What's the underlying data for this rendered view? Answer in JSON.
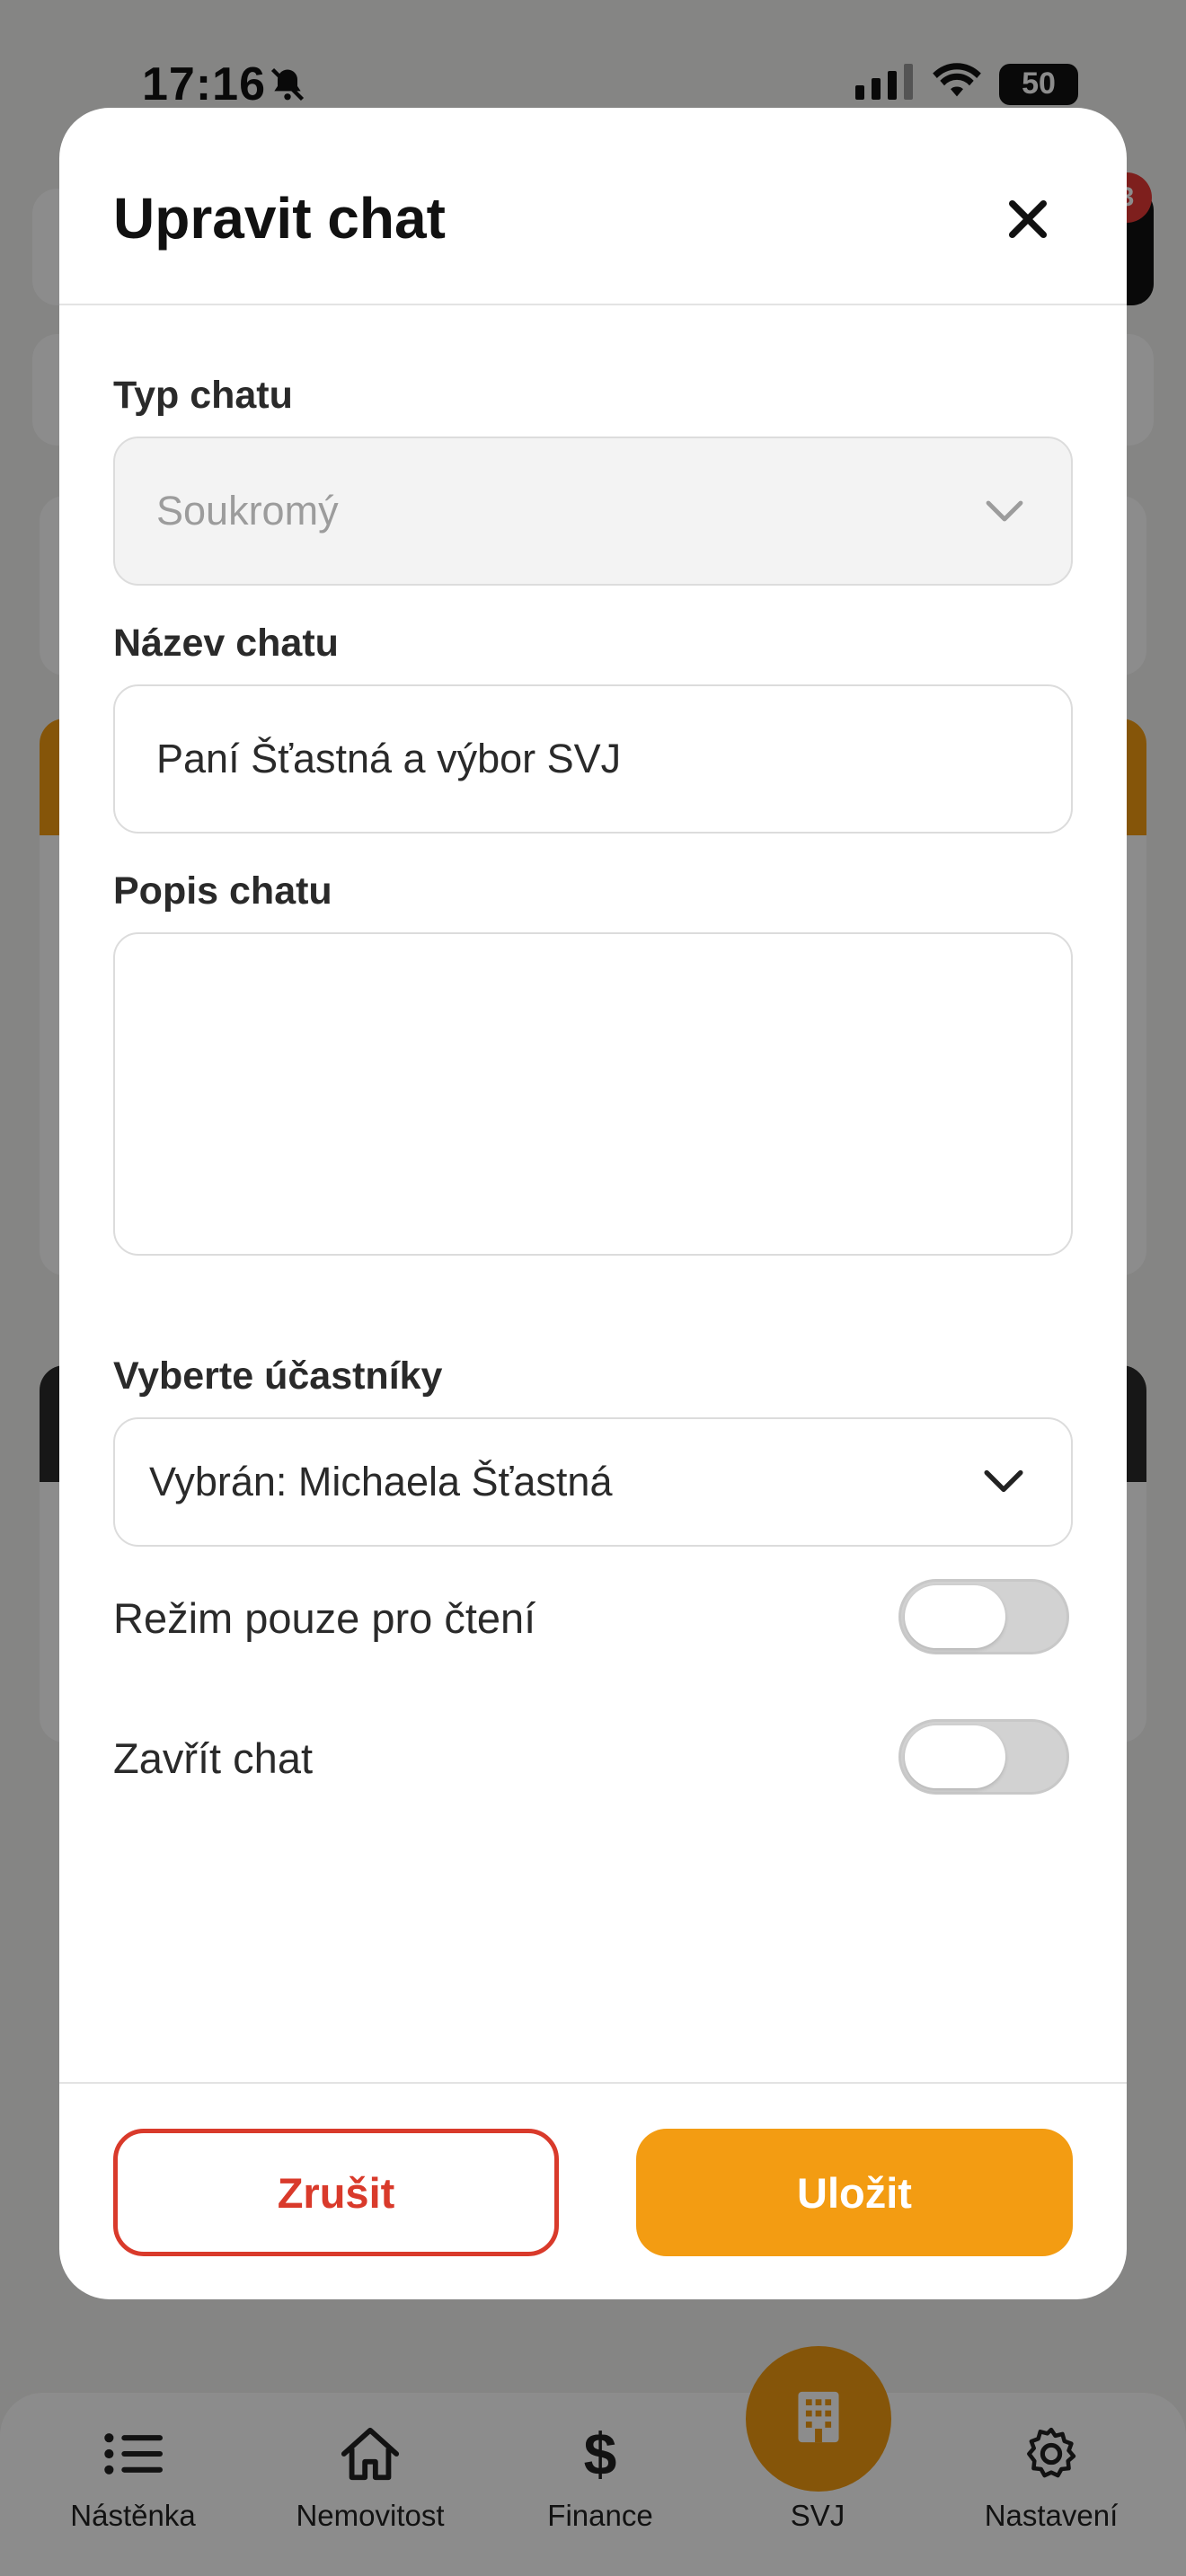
{
  "status_bar": {
    "time": "17:16",
    "battery": "50"
  },
  "modal": {
    "title": "Upravit chat",
    "chat_type": {
      "label": "Typ chatu",
      "value": "Soukromý"
    },
    "chat_name": {
      "label": "Název chatu",
      "value": "Paní Šťastná a výbor SVJ"
    },
    "chat_description": {
      "label": "Popis chatu",
      "value": ""
    },
    "participants": {
      "label": "Vyberte účastníky",
      "value": "Vybrán: Michaela Šťastná"
    },
    "read_only": {
      "label": "Režim pouze pro čtení",
      "enabled": false
    },
    "close_chat": {
      "label": "Zavřít chat",
      "enabled": false
    },
    "cancel_label": "Zrušit",
    "save_label": "Uložit"
  },
  "tab_bar": {
    "items": [
      {
        "label": "Nástěnka",
        "icon": "list-icon"
      },
      {
        "label": "Nemovitost",
        "icon": "home-icon"
      },
      {
        "label": "Finance",
        "icon": "dollar-icon"
      },
      {
        "label": "SVJ",
        "icon": "building-icon"
      },
      {
        "label": "Nastavení",
        "icon": "gear-icon"
      }
    ]
  },
  "background": {
    "badge_count": "3"
  },
  "colors": {
    "accent": "#f39c12",
    "danger": "#d93a2b"
  }
}
